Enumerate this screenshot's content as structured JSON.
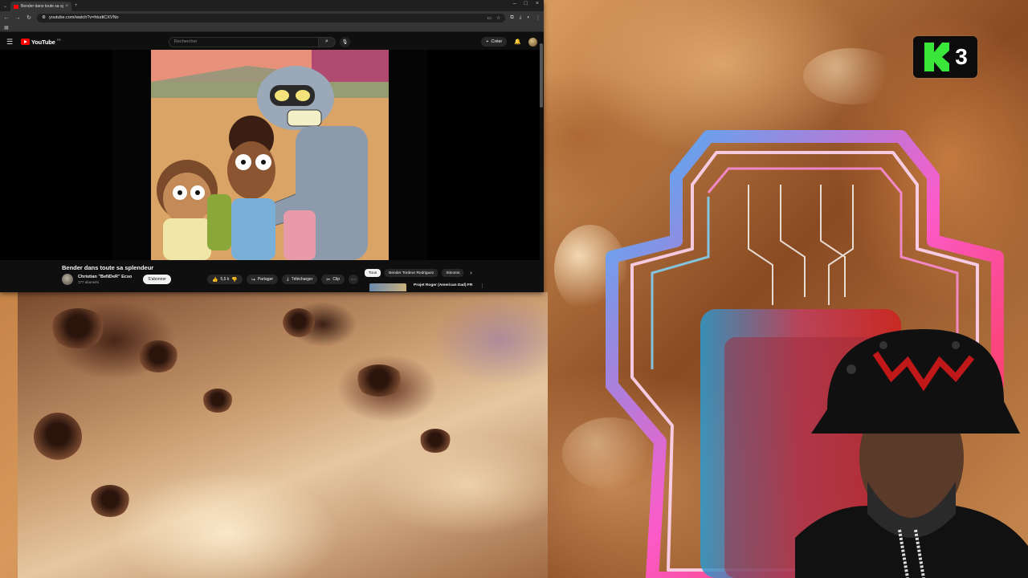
{
  "browser": {
    "tab_title": "Bender dans toute sa splen",
    "url": "youtube.com/watch?v=htudiCXVNo"
  },
  "youtube": {
    "logo_text": "YouTube",
    "country": "FR",
    "search_placeholder": "Rechercher",
    "create_label": "Créer"
  },
  "video": {
    "title": "Bender dans toute sa splendeur",
    "channel": "Christian \"BeNDeR\" Ecso",
    "subscribers": "177 abonnés",
    "subscribe_label": "S'abonner",
    "likes": "5,5 k",
    "share_label": "Partager",
    "download_label": "Télécharger",
    "clip_label": "Clip"
  },
  "chips": [
    "Tous",
    "Bender Tordeur Rodriguez",
    "Sitcoms"
  ],
  "recommendation": {
    "title": "Projet Roger (American Dad) FR"
  },
  "overlay": {
    "channel_logo_number": "3",
    "logo_color": "#39e639"
  },
  "icons": {
    "menu": "hamburger-icon",
    "search": "search-icon",
    "mic": "mic-icon",
    "bell": "bell-icon",
    "like": "thumbs-up-icon",
    "dislike": "thumbs-down-icon",
    "share": "share-icon",
    "download": "download-icon",
    "clip": "scissors-icon"
  }
}
